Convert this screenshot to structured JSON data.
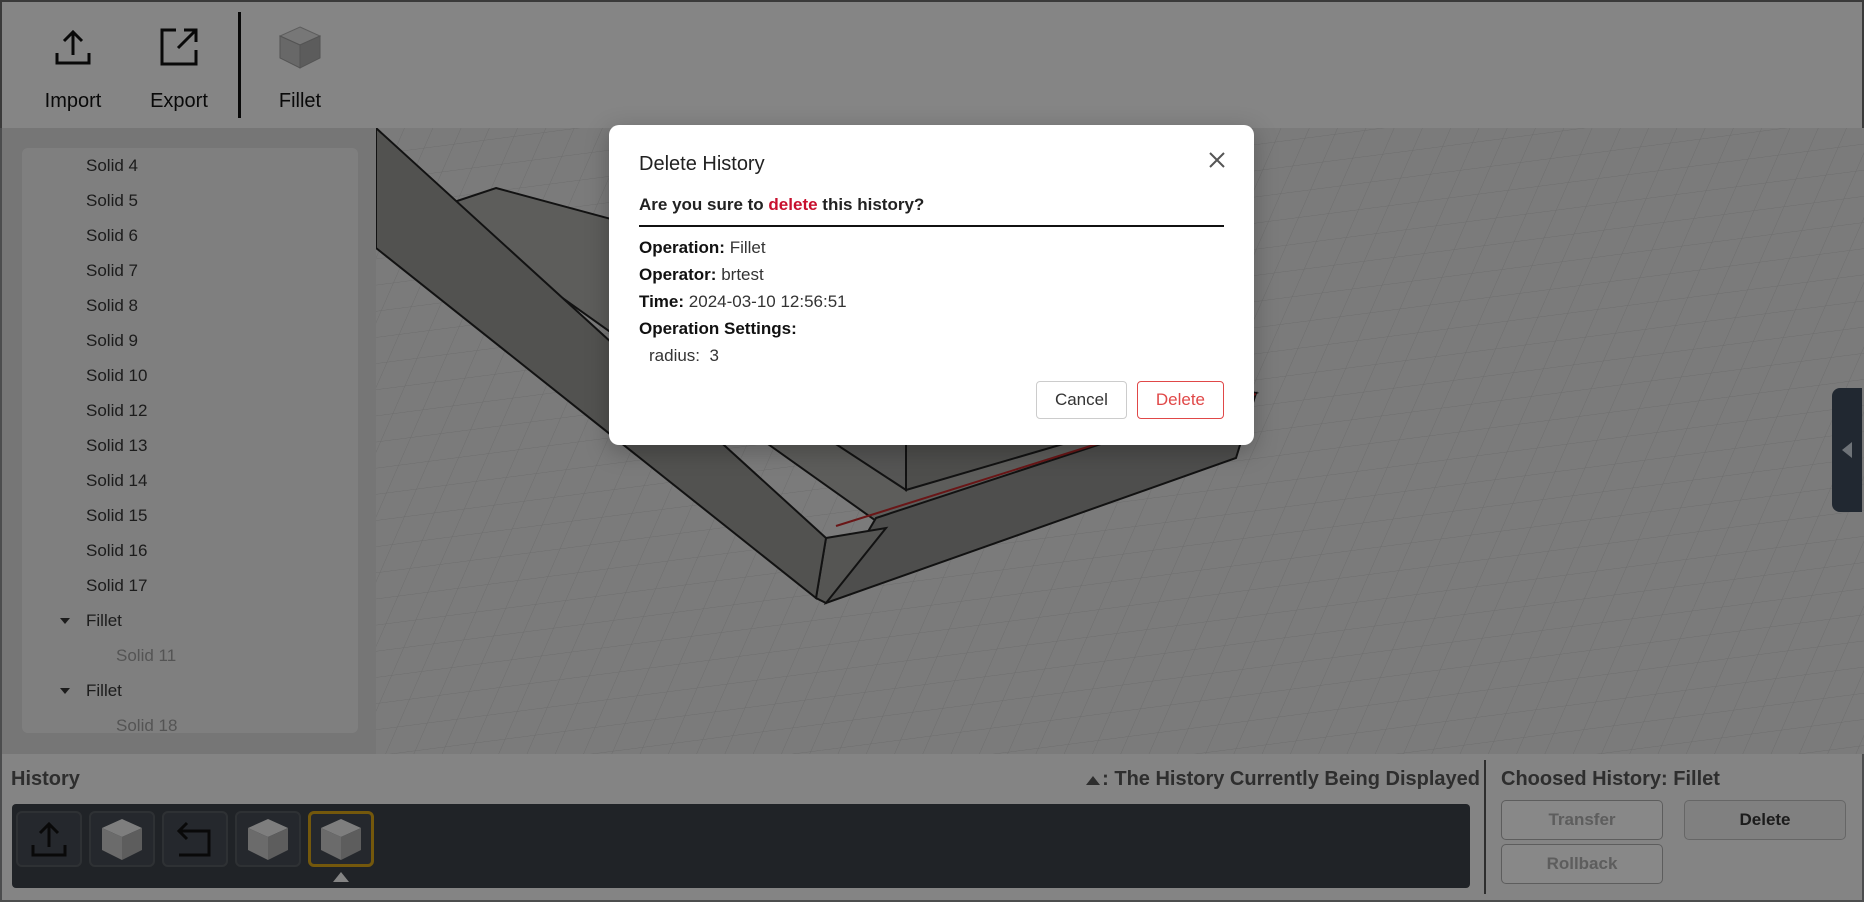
{
  "toolbar": {
    "import_label": "Import",
    "export_label": "Export",
    "fillet_label": "Fillet"
  },
  "tree": {
    "items": [
      {
        "label": "Solid 4",
        "level": 1
      },
      {
        "label": "Solid 5",
        "level": 1
      },
      {
        "label": "Solid 6",
        "level": 1
      },
      {
        "label": "Solid 7",
        "level": 1
      },
      {
        "label": "Solid 8",
        "level": 1
      },
      {
        "label": "Solid 9",
        "level": 1
      },
      {
        "label": "Solid 10",
        "level": 1
      },
      {
        "label": "Solid 12",
        "level": 1
      },
      {
        "label": "Solid 13",
        "level": 1
      },
      {
        "label": "Solid 14",
        "level": 1
      },
      {
        "label": "Solid 15",
        "level": 1
      },
      {
        "label": "Solid 16",
        "level": 1
      },
      {
        "label": "Solid 17",
        "level": 1
      },
      {
        "label": "Fillet",
        "level": 0
      },
      {
        "label": "Solid 11",
        "level": 2
      },
      {
        "label": "Fillet",
        "level": 0
      },
      {
        "label": "Solid 18",
        "level": 2
      }
    ]
  },
  "history": {
    "title": "History",
    "legend": ": The History Currently Being Displayed",
    "items": [
      "import-icon",
      "cube-icon",
      "rollback-icon",
      "cube-icon",
      "cube-icon"
    ],
    "chosen_title": "Choosed History: Fillet",
    "transfer_label": "Transfer",
    "rollback_label": "Rollback",
    "delete_label": "Delete"
  },
  "modal": {
    "title": "Delete History",
    "confirm_prefix": "Are you sure to ",
    "confirm_danger": "delete",
    "confirm_suffix": " this history?",
    "operation_key": "Operation:",
    "operation_value": "Fillet",
    "operator_key": "Operator:",
    "operator_value": "brtest",
    "time_key": "Time:",
    "time_value": "2024-03-10 12:56:51",
    "settings_key": "Operation Settings:",
    "setting_radius": "radius:  3",
    "cancel_label": "Cancel",
    "delete_label": "Delete"
  },
  "colors": {
    "danger": "#c8102e",
    "active_history": "#d4a017",
    "selected_edge": "#c0282a"
  }
}
